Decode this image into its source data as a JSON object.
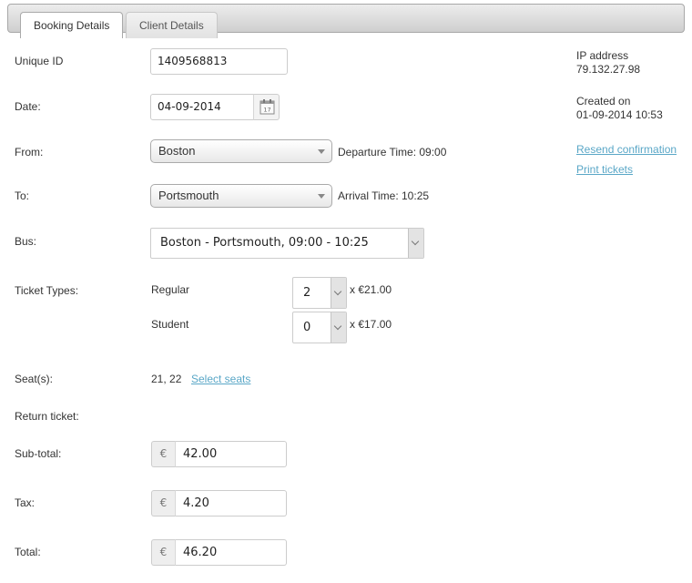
{
  "tabs": [
    {
      "label": "Booking Details",
      "active": true
    },
    {
      "label": "Client Details",
      "active": false
    }
  ],
  "form": {
    "unique_id": {
      "label": "Unique ID",
      "value": "1409568813"
    },
    "date": {
      "label": "Date:",
      "value": "04-09-2014",
      "calendar_icon": "calendar-icon",
      "calendar_day": "17"
    },
    "from": {
      "label": "From:",
      "value": "Boston",
      "time_text": "Departure Time: 09:00"
    },
    "to": {
      "label": "To:",
      "value": "Portsmouth",
      "time_text": "Arrival Time: 10:25"
    },
    "bus": {
      "label": "Bus:",
      "value": "Boston - Portsmouth, 09:00 - 10:25"
    },
    "ticket_types": {
      "label": "Ticket Types:",
      "items": [
        {
          "name": "Regular",
          "quantity": "2",
          "price_text": "x €21.00"
        },
        {
          "name": "Student",
          "quantity": "0",
          "price_text": "x €17.00"
        }
      ]
    },
    "seats": {
      "label": "Seat(s):",
      "value": "21, 22",
      "link": "Select seats"
    },
    "return_ticket": {
      "label": "Return ticket:"
    },
    "subtotal": {
      "label": "Sub-total:",
      "currency": "€",
      "value": "42.00"
    },
    "tax": {
      "label": "Tax:",
      "currency": "€",
      "value": "4.20"
    },
    "total": {
      "label": "Total:",
      "currency": "€",
      "value": "46.20"
    }
  },
  "sidebar": {
    "ip_label": "IP address",
    "ip_value": "79.132.27.98",
    "created_label": "Created on",
    "created_value": "01-09-2014 10:53",
    "links": [
      "Resend confirmation",
      "Print tickets"
    ]
  }
}
